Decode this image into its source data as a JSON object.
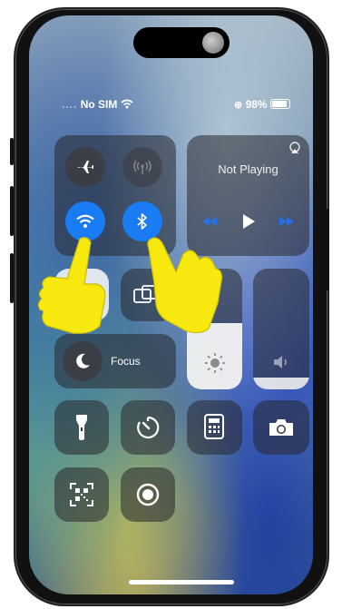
{
  "status": {
    "carrier": "No SIM",
    "battery_percent": "98%",
    "battery_level": 0.98
  },
  "connectivity": {
    "airplane": {
      "icon": "airplane-icon",
      "active": false
    },
    "cellular": {
      "icon": "cellular-antenna-icon",
      "active": false
    },
    "wifi": {
      "icon": "wifi-icon",
      "active": true
    },
    "bluetooth": {
      "icon": "bluetooth-icon",
      "active": true
    }
  },
  "media": {
    "status": "Not Playing",
    "icons": [
      "airplay-icon",
      "rewind-icon",
      "play-icon",
      "fast-forward-icon"
    ]
  },
  "focus": {
    "label": "Focus",
    "icon": "moon-icon"
  },
  "brightness": {
    "icon": "sun-icon",
    "level": 0.55
  },
  "volume": {
    "icon": "speaker-icon",
    "level": 0.1
  },
  "shortcuts": [
    "flashlight-icon",
    "timer-icon",
    "calculator-icon",
    "camera-icon",
    "qr-code-scanner-icon",
    "screen-record-icon"
  ],
  "colors": {
    "accent": "#1a7cf5",
    "pointer": "#f7e90f"
  }
}
